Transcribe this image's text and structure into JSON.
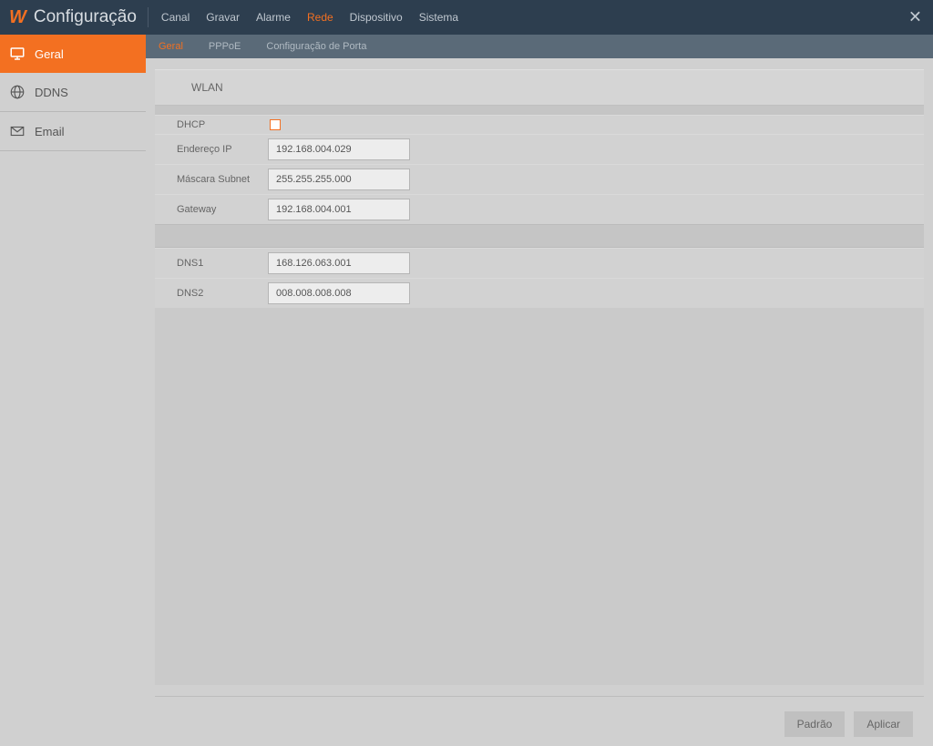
{
  "header": {
    "title": "Configuração",
    "nav": [
      "Canal",
      "Gravar",
      "Alarme",
      "Rede",
      "Dispositivo",
      "Sistema"
    ],
    "active_nav": 3
  },
  "sidebar": {
    "items": [
      {
        "label": "Geral",
        "icon": "monitor"
      },
      {
        "label": "DDNS",
        "icon": "globe"
      },
      {
        "label": "Email",
        "icon": "mail"
      }
    ],
    "active": 0
  },
  "subtabs": {
    "items": [
      "Geral",
      "PPPoE",
      "Configuração de Porta"
    ],
    "active": 0
  },
  "form": {
    "section_title": "WLAN",
    "dhcp_label": "DHCP",
    "dhcp_checked": false,
    "ip_label": "Endereço IP",
    "ip_value": "192.168.004.029",
    "subnet_label": "Máscara Subnet",
    "subnet_value": "255.255.255.000",
    "gateway_label": "Gateway",
    "gateway_value": "192.168.004.001",
    "dns1_label": "DNS1",
    "dns1_value": "168.126.063.001",
    "dns2_label": "DNS2",
    "dns2_value": "008.008.008.008"
  },
  "footer": {
    "default_btn": "Padrão",
    "apply_btn": "Aplicar"
  }
}
